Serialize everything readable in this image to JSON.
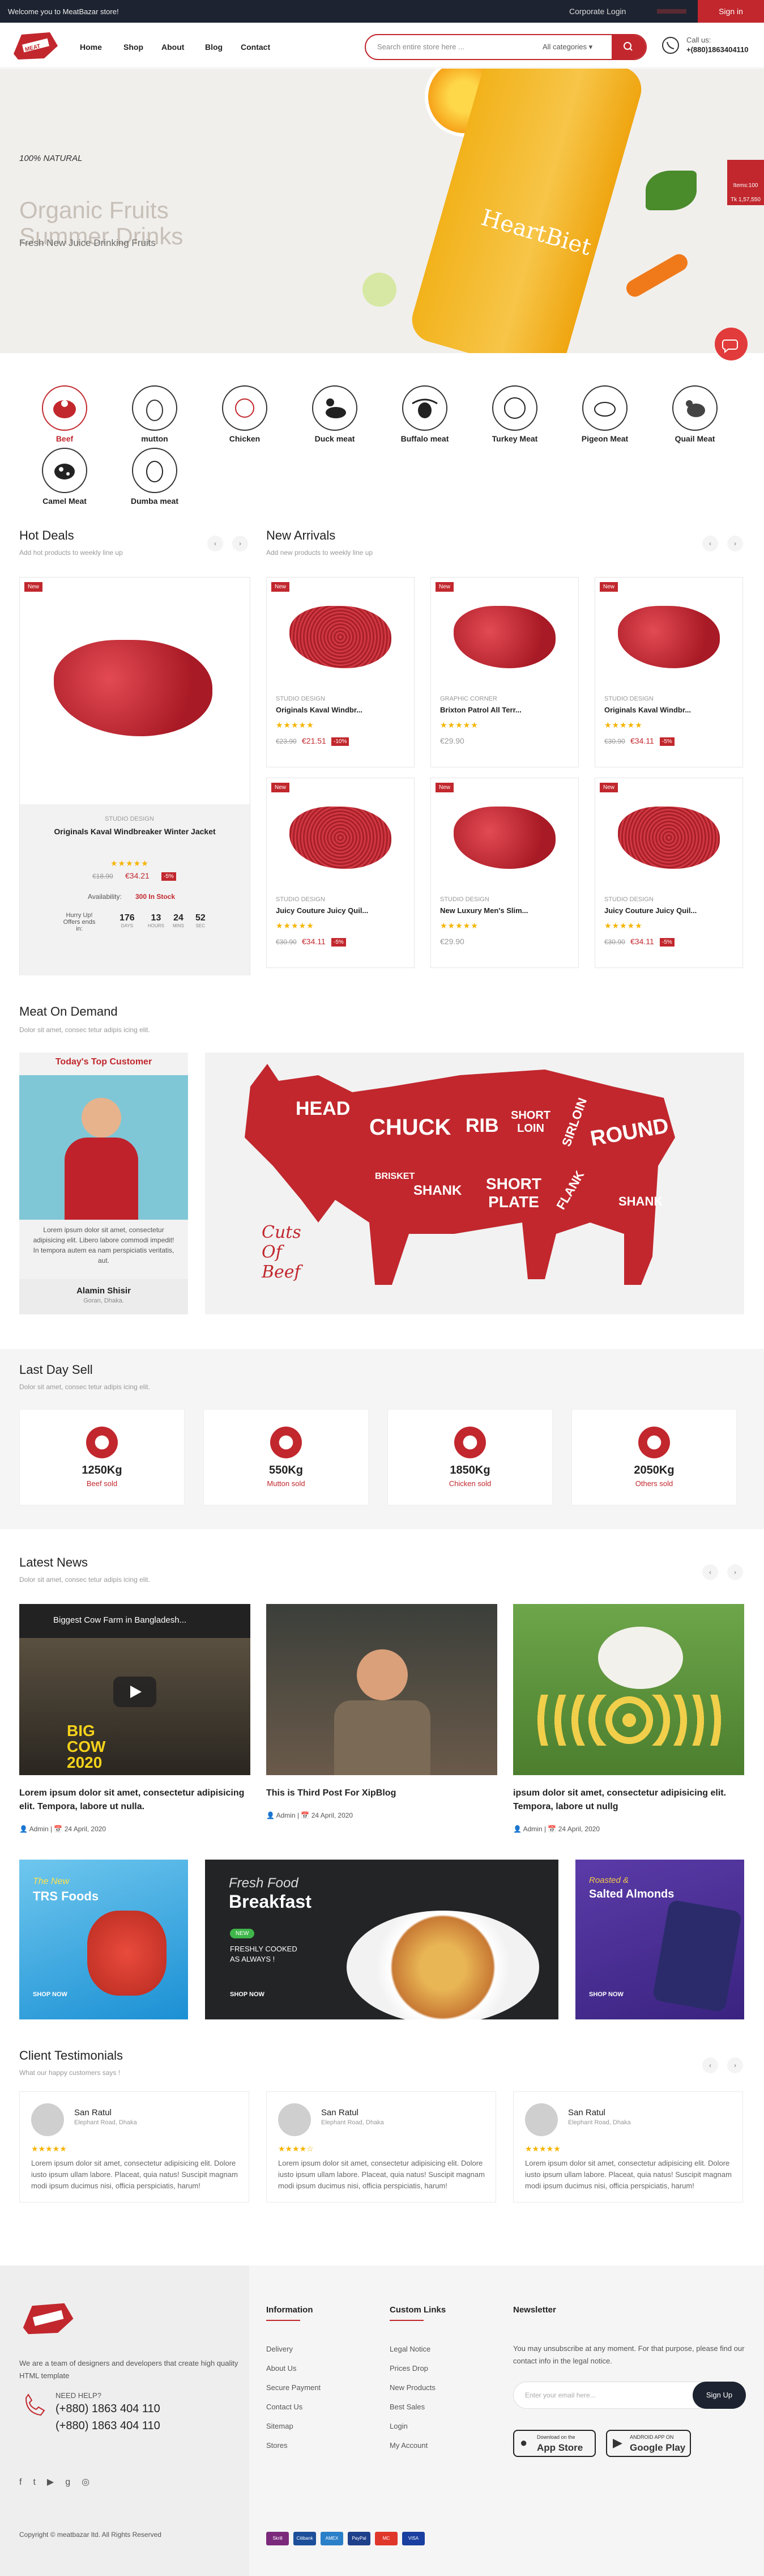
{
  "topbar": {
    "welcome": "Welcome you to MeatBazar store!",
    "corporate": "Corporate Login",
    "signin": "Sign in"
  },
  "header": {
    "nav": [
      "Home",
      "Shop",
      "About",
      "Blog",
      "Contact"
    ],
    "search_placeholder": "Search entire store here ...",
    "category": "All categories",
    "call_label": "Call us:",
    "call_number": "+(880)1863404110"
  },
  "hero": {
    "natural": "100% NATURAL",
    "title1": "Organic Fruits",
    "title2": "Summer Drinks",
    "subtitle": "Fresh New Juice Drinking Fruits",
    "bottle_brand": "HeartBiet"
  },
  "cart": {
    "items": "Items:100",
    "total": "Tk 1,57,550"
  },
  "categories": [
    "Beef",
    "mutton",
    "Chicken",
    "Duck meat",
    "Buffalo meat",
    "Turkey Meat",
    "Pigeon Meat",
    "Quail Meat",
    "Camel Meat",
    "Dumba meat"
  ],
  "hot_deals": {
    "title": "Hot Deals",
    "subtitle": "Add hot products to weekly line up",
    "badge": "New",
    "studio": "STUDIO DESIGN",
    "name": "Originals Kaval Windbreaker Winter Jacket",
    "stars": "★★★★★",
    "old": "€18.90",
    "price": "€34.21",
    "off": "-5%",
    "availability_label": "Availability:",
    "availability": "300 In Stock",
    "hurry": "Hurry Up! Offers ends in:",
    "countdown": [
      {
        "v": "176",
        "l": "DAYS"
      },
      {
        "v": "13",
        "l": "HOURS"
      },
      {
        "v": "24",
        "l": "MINS"
      },
      {
        "v": "52",
        "l": "SEC"
      }
    ]
  },
  "new_arrivals": {
    "title": "New Arrivals",
    "subtitle": "Add new products to weekly line up",
    "items": [
      {
        "badge": "New",
        "studio": "STUDIO DESIGN",
        "name": "Originals Kaval Windbr...",
        "stars": "★★★★★",
        "old": "€23.90",
        "price": "€21.51",
        "off": "-10%"
      },
      {
        "badge": "New",
        "studio": "GRAPHIC CORNER",
        "name": "Brixton Patrol All Terr...",
        "stars": "★★★★★",
        "old": "",
        "price": "€29.90",
        "off": ""
      },
      {
        "badge": "New",
        "studio": "STUDIO DESIGN",
        "name": "Originals Kaval Windbr...",
        "stars": "★★★★★",
        "old": "€30.90",
        "price": "€34.11",
        "off": "-5%"
      },
      {
        "badge": "New",
        "studio": "STUDIO DESIGN",
        "name": "Juicy Couture Juicy Quil...",
        "stars": "★★★★★",
        "old": "€30.90",
        "price": "€34.11",
        "off": "-5%"
      },
      {
        "badge": "New",
        "studio": "STUDIO DESIGN",
        "name": "New Luxury Men's Slim...",
        "stars": "★★★★★",
        "old": "",
        "price": "€29.90",
        "off": ""
      },
      {
        "badge": "New",
        "studio": "STUDIO DESIGN",
        "name": "Juicy Couture Juicy Quil...",
        "stars": "★★★★★",
        "old": "€30.90",
        "price": "€34.11",
        "off": "-5%"
      }
    ]
  },
  "demand": {
    "title": "Meat On Demand",
    "subtitle": "Dolor sit amet, consec tetur adipis icing elit.",
    "customer_title": "Today's Top Customer",
    "customer_text": "Lorem ipsum dolor sit amet, consectetur adipisicing elit. Libero labore commodi impedit! In tempora autem ea nam perspiciatis veritatis, aut.",
    "customer_name": "Alamin Shisir",
    "customer_loc": "Goran, Dhaka.",
    "cow_labels": [
      "HEAD",
      "CHUCK",
      "RIB",
      "SHORT LOIN",
      "SIRLOIN",
      "ROUND",
      "BRISKET",
      "SHANK",
      "SHORT PLATE",
      "FLANK",
      "SHANK"
    ],
    "cuts": "Cuts Of Beef"
  },
  "last_day": {
    "title": "Last Day Sell",
    "subtitle": "Dolor sit amet, consec tetur adipis icing elit.",
    "stats": [
      {
        "v": "1250Kg",
        "l": "Beef sold"
      },
      {
        "v": "550Kg",
        "l": "Mutton sold"
      },
      {
        "v": "1850Kg",
        "l": "Chicken sold"
      },
      {
        "v": "2050Kg",
        "l": "Others sold"
      }
    ]
  },
  "news": {
    "title": "Latest News",
    "subtitle": "Dolor sit amet, consec tetur adipis icing elit.",
    "video_title": "Biggest Cow Farm in Bangladesh...",
    "video_overlay": "BIG COW 2020",
    "items": [
      {
        "title": "Lorem ipsum dolor sit amet, consectetur adipisicing elit. Tempora, labore ut nulla.",
        "author": "Admin",
        "date": "24 April, 2020"
      },
      {
        "title": "This is Third Post For XipBlog",
        "author": "Admin",
        "date": "24 April, 2020"
      },
      {
        "title": "ipsum dolor sit amet, consectetur adipisicing elit. Tempora, labore ut nullg",
        "author": "Admin",
        "date": "24 April, 2020"
      }
    ]
  },
  "banners": [
    {
      "pre": "The New",
      "title": "TRS Foods",
      "btn": "SHOP NOW"
    },
    {
      "pre": "Fresh Food",
      "title": "Breakfast",
      "tag": "NEW",
      "line1": "FRESHLY COOKED",
      "line2": "AS ALWAYS !",
      "btn": "SHOP NOW"
    },
    {
      "pre": "Roasted &",
      "title": "Salted Almonds",
      "btn": "SHOP NOW"
    }
  ],
  "testimonials": {
    "title": "Client Testimonials",
    "subtitle": "What our happy customers says !",
    "items": [
      {
        "name": "San Ratul",
        "loc": "Elephant Road, Dhaka",
        "stars": "★★★★★",
        "text": "Lorem ipsum dolor sit amet, consectetur adipisicing elit. Dolore iusto ipsum ullam labore. Placeat, quia natus! Suscipit magnam modi ipsum ducimus nisi, officia perspiciatis, harum!"
      },
      {
        "name": "San Ratul",
        "loc": "Elephant Road, Dhaka",
        "stars": "★★★★☆",
        "text": "Lorem ipsum dolor sit amet, consectetur adipisicing elit. Dolore iusto ipsum ullam labore. Placeat, quia natus! Suscipit magnam modi ipsum ducimus nisi, officia perspiciatis, harum!"
      },
      {
        "name": "San Ratul",
        "loc": "Elephant Road, Dhaka",
        "stars": "★★★★★",
        "text": "Lorem ipsum dolor sit amet, consectetur adipisicing elit. Dolore iusto ipsum ullam labore. Placeat, quia natus! Suscipit magnam modi ipsum ducimus nisi, officia perspiciatis, harum!"
      }
    ]
  },
  "footer": {
    "about": "We are a team of designers and developers that create high quality HTML template",
    "help": "NEED HELP?",
    "phone1": "(+880) 1863 404 110",
    "phone2": "(+880) 1863 404 110",
    "info_title": "Information",
    "info": [
      "Delivery",
      "About Us",
      "Secure Payment",
      "Contact Us",
      "Sitemap",
      "Stores"
    ],
    "links_title": "Custom Links",
    "links": [
      "Legal Notice",
      "Prices Drop",
      "New Products",
      "Best Sales",
      "Login",
      "My Account"
    ],
    "news_title": "Newsletter",
    "news_text": "You may unsubscribe at any moment. For that purpose, please find our contact info in the legal notice.",
    "email_ph": "Enter your email here...",
    "signup": "Sign Up",
    "app1_small": "Download on the",
    "app1": "App Store",
    "app2_small": "ANDROID APP ON",
    "app2": "Google Play",
    "copyright": "Copyright © meatbazar ltd. All Rights Reserved",
    "payments": [
      "Skrill",
      "Citibank",
      "AMEX",
      "PayPal",
      "MC",
      "VISA"
    ]
  },
  "colors": {
    "accent": "#c1272d",
    "dark": "#1d2330"
  }
}
